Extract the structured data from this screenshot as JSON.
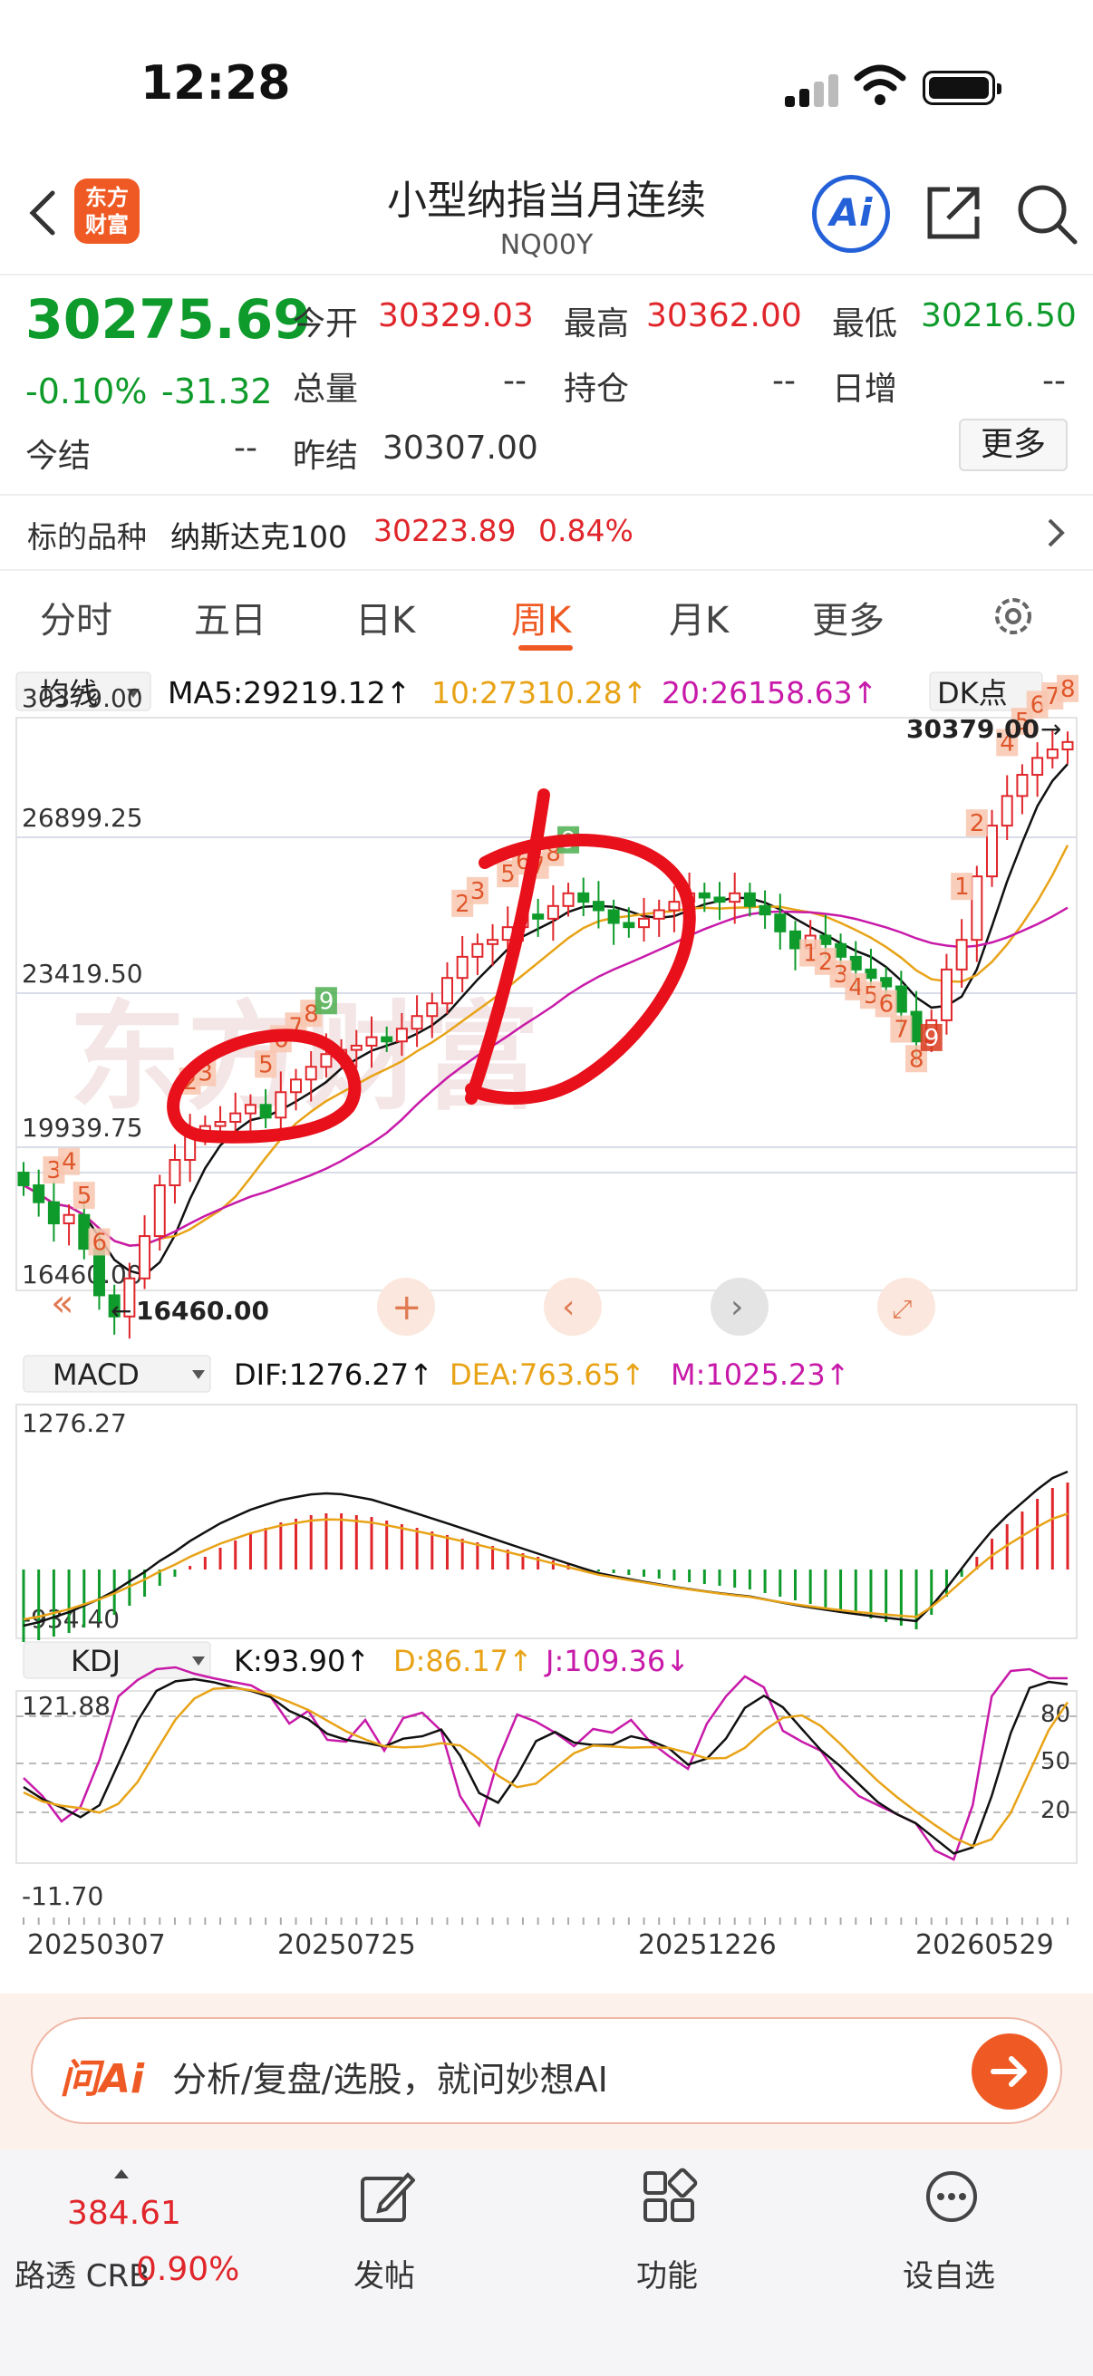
{
  "status_bar": {
    "time": "12:28"
  },
  "header": {
    "logo_text_line1": "东方",
    "logo_text_line2": "财富",
    "title": "小型纳指当月连续",
    "code": "NQ00Y",
    "ai_label": "Ai"
  },
  "quote": {
    "price": "30275.69",
    "change_pct": "-0.10%",
    "change_abs": "-31.32",
    "open_label": "今开",
    "open": "30329.03",
    "high_label": "最高",
    "high": "30362.00",
    "low_label": "最低",
    "low": "30216.50",
    "volume_label": "总量",
    "volume": "--",
    "position_label": "持仓",
    "position": "--",
    "daily_inc_label": "日增",
    "daily_inc": "--",
    "today_settle_label": "今结",
    "today_settle": "--",
    "prev_settle_label": "昨结",
    "prev_settle": "30307.00",
    "more_label": "更多"
  },
  "underlying": {
    "label": "标的品种",
    "name": "纳斯达克100",
    "price": "30223.89",
    "pct": "0.84%"
  },
  "tabs": [
    "分时",
    "五日",
    "日K",
    "周K",
    "月K",
    "更多"
  ],
  "active_tab": "周K",
  "chart": {
    "indicator_select": "均线",
    "ma5": "MA5:29219.12↑",
    "ma10": "10:27310.28↑",
    "ma20": "20:26158.63↑",
    "dk_label": "DK点",
    "y_labels": [
      "30379.00",
      "26899.25",
      "23419.50",
      "19939.75",
      "16460.00"
    ],
    "max_label": "30379.00",
    "min_label": "16460.00",
    "macd_select": "MACD",
    "dif": "DIF:1276.27↑",
    "dea": "DEA:763.65↑",
    "m": "M:1025.23↑",
    "macd_top": "1276.27",
    "macd_bottom": "-934.40",
    "kdj_select": "KDJ",
    "k": "K:93.90↑",
    "d": "D:86.17↑",
    "j": "J:109.36↓",
    "kdj_top": "121.88",
    "kdj_bottom": "-11.70",
    "kdj_levels": [
      "80",
      "50",
      "20"
    ],
    "dates": [
      "20250307",
      "20250725",
      "20251226",
      "20260529"
    ],
    "colors": {
      "up": "#e0262b",
      "down": "#0f9b2b",
      "ma5": "#111111",
      "ma10": "#e8a317",
      "ma20": "#c81aa9",
      "annotation": "#e8101a"
    }
  },
  "ai_bar": {
    "logo": "问Ai",
    "placeholder": "分析/复盘/选股，就问妙想AI"
  },
  "bottom_bar": {
    "crb_value": "384.61",
    "crb_label": "路透 CRB",
    "crb_pct": "0.90%",
    "post_label": "发帖",
    "func_label": "功能",
    "watch_label": "设自选"
  }
}
